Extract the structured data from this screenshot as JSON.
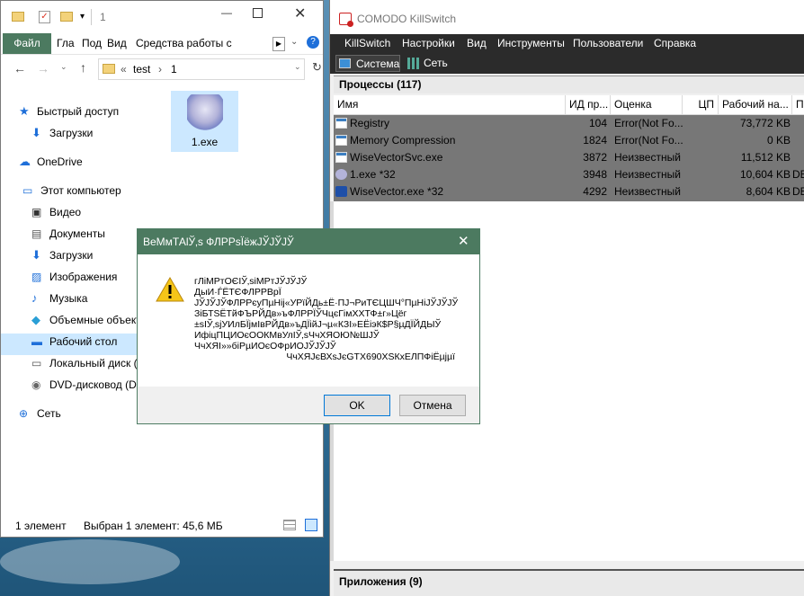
{
  "explorer": {
    "title_path": "1",
    "ribbon_tabs": [
      "Файл",
      "Гла",
      "Под",
      "Вид",
      "Средства работы с приложе"
    ],
    "address": [
      "test",
      "1"
    ],
    "nav": [
      {
        "label": "Быстрый доступ",
        "icon": "star-icon"
      },
      {
        "label": "Загрузки",
        "icon": "download-icon"
      },
      {
        "label": "OneDrive",
        "icon": "cloud-icon"
      },
      {
        "label": "Этот компьютер",
        "icon": "computer-icon"
      },
      {
        "label": "Видео",
        "icon": "video-icon"
      },
      {
        "label": "Документы",
        "icon": "document-icon"
      },
      {
        "label": "Загрузки",
        "icon": "download-icon"
      },
      {
        "label": "Изображения",
        "icon": "image-icon"
      },
      {
        "label": "Музыка",
        "icon": "music-icon"
      },
      {
        "label": "Объемные объекты",
        "icon": "cube-icon"
      },
      {
        "label": "Рабочий стол",
        "icon": "desktop-icon"
      },
      {
        "label": "Локальный диск (",
        "icon": "disk-icon"
      },
      {
        "label": "DVD-дисковод (D:",
        "icon": "dvd-icon"
      },
      {
        "label": "Сеть",
        "icon": "network-icon"
      }
    ],
    "file": {
      "name": "1.exe"
    },
    "status": {
      "count": "1 элемент",
      "selected": "Выбран 1 элемент: 45,6 МБ"
    }
  },
  "comodo": {
    "title": "COMODO KillSwitch",
    "menu": [
      "KillSwitch",
      "Настройки",
      "Вид",
      "Инструменты",
      "Пользователи",
      "Справка"
    ],
    "tabs": [
      "Система",
      "Сеть"
    ],
    "processes_header": "Процессы (117)",
    "columns": [
      "Имя",
      "ИД пр...",
      "Оценка",
      "ЦП",
      "Рабочий на...",
      "П"
    ],
    "rows": [
      {
        "name": "Registry",
        "pid": "104",
        "rating": "Error(Not Fo...",
        "cpu": "",
        "mem": "73,772 KB",
        "extra": ""
      },
      {
        "name": "Memory Compression",
        "pid": "1824",
        "rating": "Error(Not Fo...",
        "cpu": "",
        "mem": "0 KB",
        "extra": ""
      },
      {
        "name": "WiseVectorSvc.exe",
        "pid": "3872",
        "rating": "Неизвестный",
        "cpu": "",
        "mem": "11,512 KB",
        "extra": ""
      },
      {
        "name": "1.exe *32",
        "pid": "3948",
        "rating": "Неизвестный",
        "cpu": "",
        "mem": "10,604 KB",
        "extra": "DE"
      },
      {
        "name": "WiseVector.exe *32",
        "pid": "4292",
        "rating": "Неизвестный",
        "cpu": "",
        "mem": "8,604 KB",
        "extra": "DE"
      }
    ],
    "apps_header": "Приложения (9)"
  },
  "dialog": {
    "title": "ВеМмТАlЎ‚s ФЛРРѕЇёжЈЎЈЎЈЎ",
    "lines": [
      "гЛiМРтОЄІЎ‚sіМРтЈЎЈЎЈЎ",
      "ДыИ·ЃЁТЄФЛРРВрЇ",
      "ЈЎЈЎЈЎФЛРРєуПµНij«УРїЙДь±Ё·ПЈ¬РиТЄЦШЧ°ПµНiЈЎЈЎЈЎ",
      "ЗiБТЅЁТйФЪРЙДв»ъФЛРРЇЎЧцєГiмХХТФ±г»Цёг",
      "±sІЎ‚sјУИлБЇјмІвРЙДв»ъДЇiйЈ¬µ«КЗI»ЕЁiэК$Р§µДЇЙДЫЎ",
      "ИфіцПЦИОєООКМвУлІЎ‚sЧчХЯОЮ№ШЈЎ",
      "ЧчХЯI»»бiРµИОєОФрИОЈЎЈЎЈЎ"
    ],
    "signature": "ЧчХЯЈєВХsЈєGTX690XSКхЕЛПФіЁµјµї",
    "ok": "OK",
    "cancel": "Отмена"
  }
}
